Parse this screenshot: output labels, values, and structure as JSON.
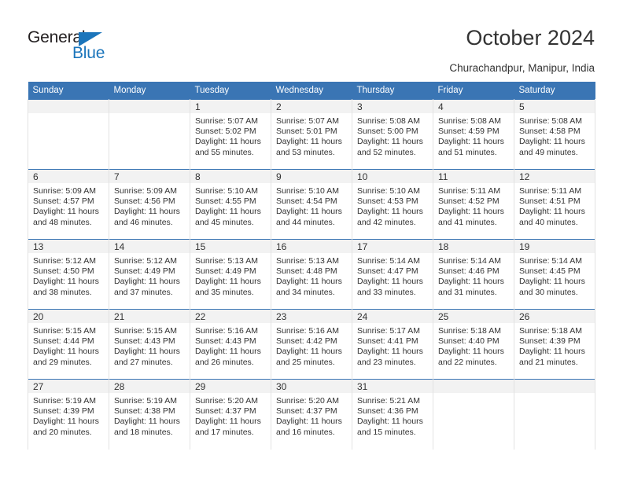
{
  "brand": {
    "name_dark": "General",
    "name_blue": "Blue",
    "accent_color": "#1b75bb",
    "header_color": "#3a75b4"
  },
  "header": {
    "title": "October 2024",
    "location": "Churachandpur, Manipur, India"
  },
  "weekdays": [
    "Sunday",
    "Monday",
    "Tuesday",
    "Wednesday",
    "Thursday",
    "Friday",
    "Saturday"
  ],
  "chart_data": {
    "type": "table",
    "title": "October 2024",
    "subtitle": "Churachandpur, Manipur, India",
    "columns": [
      "Sunday",
      "Monday",
      "Tuesday",
      "Wednesday",
      "Thursday",
      "Friday",
      "Saturday"
    ],
    "weeks": [
      [
        {
          "day": "",
          "lines": []
        },
        {
          "day": "",
          "lines": []
        },
        {
          "day": "1",
          "lines": [
            "Sunrise: 5:07 AM",
            "Sunset: 5:02 PM",
            "Daylight: 11 hours",
            "and 55 minutes."
          ]
        },
        {
          "day": "2",
          "lines": [
            "Sunrise: 5:07 AM",
            "Sunset: 5:01 PM",
            "Daylight: 11 hours",
            "and 53 minutes."
          ]
        },
        {
          "day": "3",
          "lines": [
            "Sunrise: 5:08 AM",
            "Sunset: 5:00 PM",
            "Daylight: 11 hours",
            "and 52 minutes."
          ]
        },
        {
          "day": "4",
          "lines": [
            "Sunrise: 5:08 AM",
            "Sunset: 4:59 PM",
            "Daylight: 11 hours",
            "and 51 minutes."
          ]
        },
        {
          "day": "5",
          "lines": [
            "Sunrise: 5:08 AM",
            "Sunset: 4:58 PM",
            "Daylight: 11 hours",
            "and 49 minutes."
          ]
        }
      ],
      [
        {
          "day": "6",
          "lines": [
            "Sunrise: 5:09 AM",
            "Sunset: 4:57 PM",
            "Daylight: 11 hours",
            "and 48 minutes."
          ]
        },
        {
          "day": "7",
          "lines": [
            "Sunrise: 5:09 AM",
            "Sunset: 4:56 PM",
            "Daylight: 11 hours",
            "and 46 minutes."
          ]
        },
        {
          "day": "8",
          "lines": [
            "Sunrise: 5:10 AM",
            "Sunset: 4:55 PM",
            "Daylight: 11 hours",
            "and 45 minutes."
          ]
        },
        {
          "day": "9",
          "lines": [
            "Sunrise: 5:10 AM",
            "Sunset: 4:54 PM",
            "Daylight: 11 hours",
            "and 44 minutes."
          ]
        },
        {
          "day": "10",
          "lines": [
            "Sunrise: 5:10 AM",
            "Sunset: 4:53 PM",
            "Daylight: 11 hours",
            "and 42 minutes."
          ]
        },
        {
          "day": "11",
          "lines": [
            "Sunrise: 5:11 AM",
            "Sunset: 4:52 PM",
            "Daylight: 11 hours",
            "and 41 minutes."
          ]
        },
        {
          "day": "12",
          "lines": [
            "Sunrise: 5:11 AM",
            "Sunset: 4:51 PM",
            "Daylight: 11 hours",
            "and 40 minutes."
          ]
        }
      ],
      [
        {
          "day": "13",
          "lines": [
            "Sunrise: 5:12 AM",
            "Sunset: 4:50 PM",
            "Daylight: 11 hours",
            "and 38 minutes."
          ]
        },
        {
          "day": "14",
          "lines": [
            "Sunrise: 5:12 AM",
            "Sunset: 4:49 PM",
            "Daylight: 11 hours",
            "and 37 minutes."
          ]
        },
        {
          "day": "15",
          "lines": [
            "Sunrise: 5:13 AM",
            "Sunset: 4:49 PM",
            "Daylight: 11 hours",
            "and 35 minutes."
          ]
        },
        {
          "day": "16",
          "lines": [
            "Sunrise: 5:13 AM",
            "Sunset: 4:48 PM",
            "Daylight: 11 hours",
            "and 34 minutes."
          ]
        },
        {
          "day": "17",
          "lines": [
            "Sunrise: 5:14 AM",
            "Sunset: 4:47 PM",
            "Daylight: 11 hours",
            "and 33 minutes."
          ]
        },
        {
          "day": "18",
          "lines": [
            "Sunrise: 5:14 AM",
            "Sunset: 4:46 PM",
            "Daylight: 11 hours",
            "and 31 minutes."
          ]
        },
        {
          "day": "19",
          "lines": [
            "Sunrise: 5:14 AM",
            "Sunset: 4:45 PM",
            "Daylight: 11 hours",
            "and 30 minutes."
          ]
        }
      ],
      [
        {
          "day": "20",
          "lines": [
            "Sunrise: 5:15 AM",
            "Sunset: 4:44 PM",
            "Daylight: 11 hours",
            "and 29 minutes."
          ]
        },
        {
          "day": "21",
          "lines": [
            "Sunrise: 5:15 AM",
            "Sunset: 4:43 PM",
            "Daylight: 11 hours",
            "and 27 minutes."
          ]
        },
        {
          "day": "22",
          "lines": [
            "Sunrise: 5:16 AM",
            "Sunset: 4:43 PM",
            "Daylight: 11 hours",
            "and 26 minutes."
          ]
        },
        {
          "day": "23",
          "lines": [
            "Sunrise: 5:16 AM",
            "Sunset: 4:42 PM",
            "Daylight: 11 hours",
            "and 25 minutes."
          ]
        },
        {
          "day": "24",
          "lines": [
            "Sunrise: 5:17 AM",
            "Sunset: 4:41 PM",
            "Daylight: 11 hours",
            "and 23 minutes."
          ]
        },
        {
          "day": "25",
          "lines": [
            "Sunrise: 5:18 AM",
            "Sunset: 4:40 PM",
            "Daylight: 11 hours",
            "and 22 minutes."
          ]
        },
        {
          "day": "26",
          "lines": [
            "Sunrise: 5:18 AM",
            "Sunset: 4:39 PM",
            "Daylight: 11 hours",
            "and 21 minutes."
          ]
        }
      ],
      [
        {
          "day": "27",
          "lines": [
            "Sunrise: 5:19 AM",
            "Sunset: 4:39 PM",
            "Daylight: 11 hours",
            "and 20 minutes."
          ]
        },
        {
          "day": "28",
          "lines": [
            "Sunrise: 5:19 AM",
            "Sunset: 4:38 PM",
            "Daylight: 11 hours",
            "and 18 minutes."
          ]
        },
        {
          "day": "29",
          "lines": [
            "Sunrise: 5:20 AM",
            "Sunset: 4:37 PM",
            "Daylight: 11 hours",
            "and 17 minutes."
          ]
        },
        {
          "day": "30",
          "lines": [
            "Sunrise: 5:20 AM",
            "Sunset: 4:37 PM",
            "Daylight: 11 hours",
            "and 16 minutes."
          ]
        },
        {
          "day": "31",
          "lines": [
            "Sunrise: 5:21 AM",
            "Sunset: 4:36 PM",
            "Daylight: 11 hours",
            "and 15 minutes."
          ]
        },
        {
          "day": "",
          "lines": []
        },
        {
          "day": "",
          "lines": []
        }
      ]
    ]
  }
}
